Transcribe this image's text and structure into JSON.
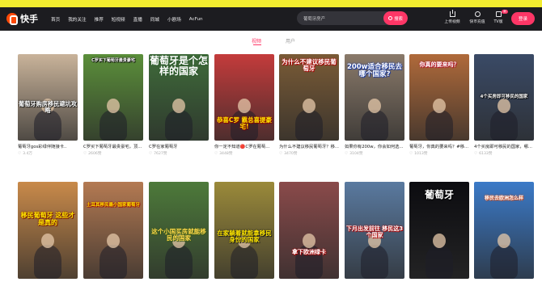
{
  "brand": {
    "name": "快手"
  },
  "nav": {
    "items": [
      "首页",
      "我的关注",
      "推荐",
      "短视频",
      "直播",
      "同城",
      "小剧场",
      "AcFun"
    ]
  },
  "search": {
    "value": "葡萄牙房产",
    "button_label": "搜索"
  },
  "toolbar": {
    "upload_label": "上传视频",
    "client_label": "快币充值",
    "tv_label": "TV版",
    "tv_badge": "新",
    "login_label": "登录"
  },
  "tabs": {
    "video": "视频",
    "user": "用户"
  },
  "row1": [
    {
      "title": "葡萄牙gos彩绿伴随接卡..",
      "likes": "3.4万",
      "caption": "葡萄牙购房移民避坑攻略",
      "bg": "#c9b39a"
    },
    {
      "title": "C罗买下葡萄牙最贵豪宅，顶...",
      "likes": "2606赞",
      "caption": "C罗买下葡萄牙最贵豪宅",
      "bg": "#5b8f3a"
    },
    {
      "title": "C罗在家葡萄牙",
      "likes": "7627赞",
      "caption": "葡萄牙是个怎样的国家",
      "bg": "#3f6b3a"
    },
    {
      "title": "你一定不知道🔴C罗在葡萄...",
      "likes": "3448赞",
      "caption": "恭喜C罗 霸总喜提豪宅!",
      "bg": "#c43b3b"
    },
    {
      "title": "为什么不建议移民葡萄牙？移...",
      "likes": "3470赞",
      "caption": "为什么不建议移民葡萄牙",
      "bg": "#7a5b36"
    },
    {
      "title": "如果你有200w，你会如何选...",
      "likes": "3104赞",
      "caption": "200w适合移民去哪个国家?",
      "bg": "#8a7a6a"
    },
    {
      "title": "葡萄牙，你真的要来吗？#移...",
      "likes": "1013赞",
      "caption": "你真的要来吗？",
      "bg": "#b06a3a"
    },
    {
      "title": "4个买房即可移民的国家，哪...",
      "likes": "6133赞",
      "caption": "4个买房即可移民的国家",
      "bg": "#3a4a66"
    }
  ],
  "row2": [
    {
      "caption": "移民葡萄牙 这些才是真的",
      "bg": "#c98a4a"
    },
    {
      "caption": "土耳其移民最小国家葡萄牙",
      "bg": "#b47a52"
    },
    {
      "caption": "这个小国买房就能移民的国家",
      "bg": "#4d7a3a"
    },
    {
      "caption": "在家躺着就能拿移民身份的国家",
      "bg": "#9b8a3a"
    },
    {
      "caption": "拿下欧洲绿卡",
      "bg": "#8a4a4a"
    },
    {
      "caption": "下月出发前往 移民这3个国家",
      "bg": "#5a7aa0"
    },
    {
      "caption": "葡萄牙",
      "bg": "#0c0c10"
    },
    {
      "caption": "移民去欧洲怎么样",
      "bg": "#3b7ac8"
    }
  ],
  "colors": {
    "accent": "#fe3666",
    "nav_bg": "#1c1c20",
    "top_strip": "#f2ec2f"
  }
}
